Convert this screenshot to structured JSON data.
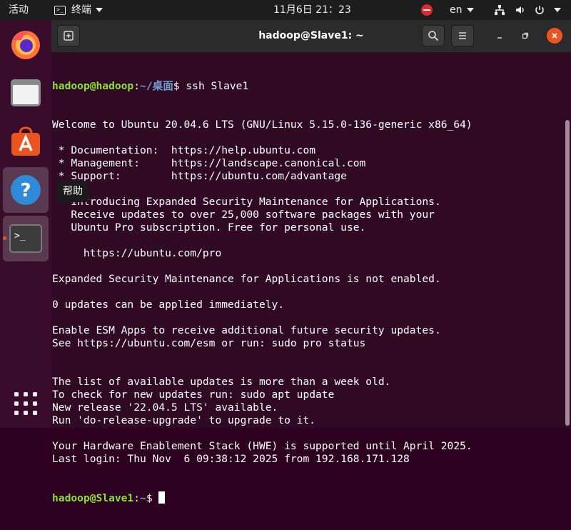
{
  "topbar": {
    "activities": "活动",
    "app_menu": "终端",
    "clock": "11月6日  21：23",
    "input_method": "en"
  },
  "dock": {
    "tooltip": "帮助"
  },
  "terminal": {
    "title": "hadoop@Slave1: ~",
    "initial_prompt": {
      "user": "hadoop@hadoop",
      "path": "~/桌面",
      "symbol": "$",
      "command": " ssh Slave1"
    },
    "output_lines": [
      "Welcome to Ubuntu 20.04.6 LTS (GNU/Linux 5.15.0-136-generic x86_64)",
      "",
      " * Documentation:  https://help.ubuntu.com",
      " * Management:     https://landscape.canonical.com",
      " * Support:        https://ubuntu.com/advantage",
      "",
      " * Introducing Expanded Security Maintenance for Applications.",
      "   Receive updates to over 25,000 software packages with your",
      "   Ubuntu Pro subscription. Free for personal use.",
      "",
      "     https://ubuntu.com/pro",
      "",
      "Expanded Security Maintenance for Applications is not enabled.",
      "",
      "0 updates can be applied immediately.",
      "",
      "Enable ESM Apps to receive additional future security updates.",
      "See https://ubuntu.com/esm or run: sudo pro status",
      "",
      "",
      "The list of available updates is more than a week old.",
      "To check for new updates run: sudo apt update",
      "New release '22.04.5 LTS' available.",
      "Run 'do-release-upgrade' to upgrade to it.",
      "",
      "Your Hardware Enablement Stack (HWE) is supported until April 2025.",
      "Last login: Thu Nov  6 09:38:12 2025 from 192.168.171.128"
    ],
    "final_prompt": {
      "user": "hadoop@Slave1",
      "path": "~",
      "symbol": "$ "
    }
  }
}
